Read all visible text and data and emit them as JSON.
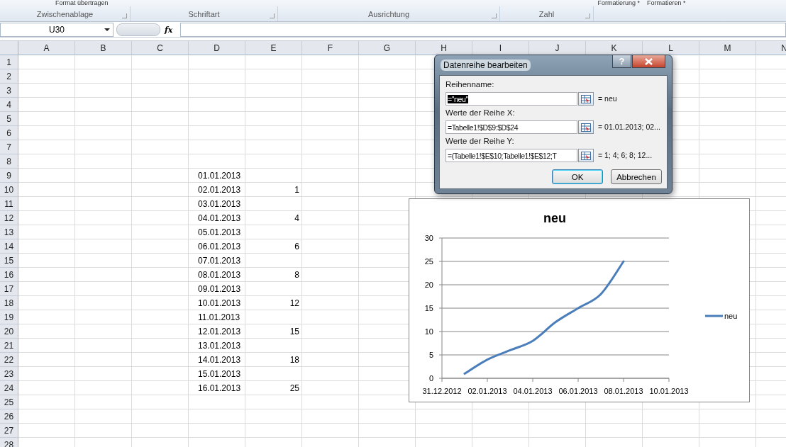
{
  "ribbon": {
    "top_items": [
      {
        "label": "Format übertragen"
      },
      {
        "label": "Formatierung *"
      },
      {
        "label": "Formatieren *"
      }
    ],
    "groups": [
      {
        "label": "Zwischenablage"
      },
      {
        "label": "Schriftart"
      },
      {
        "label": "Ausrichtung"
      },
      {
        "label": "Zahl"
      }
    ]
  },
  "formula_bar": {
    "name_box": "U30",
    "function_label": "fx"
  },
  "sheet": {
    "columns": [
      "A",
      "B",
      "C",
      "D",
      "E",
      "F",
      "G",
      "H",
      "I",
      "J",
      "K",
      "L",
      "M",
      "N"
    ],
    "rows": [
      {
        "header": "1"
      },
      {
        "header": "2"
      },
      {
        "header": "3"
      },
      {
        "header": "4"
      },
      {
        "header": "5"
      },
      {
        "header": "6"
      },
      {
        "header": "7"
      },
      {
        "header": "8"
      },
      {
        "header": "9",
        "date": "01.01.2013"
      },
      {
        "header": "10",
        "date": "02.01.2013",
        "value": "1"
      },
      {
        "header": "11",
        "date": "03.01.2013"
      },
      {
        "header": "12",
        "date": "04.01.2013",
        "value": "4"
      },
      {
        "header": "13",
        "date": "05.01.2013"
      },
      {
        "header": "14",
        "date": "06.01.2013",
        "value": "6"
      },
      {
        "header": "15",
        "date": "07.01.2013"
      },
      {
        "header": "16",
        "date": "08.01.2013",
        "value": "8"
      },
      {
        "header": "17",
        "date": "09.01.2013"
      },
      {
        "header": "18",
        "date": "10.01.2013",
        "value": "12"
      },
      {
        "header": "19",
        "date": "11.01.2013"
      },
      {
        "header": "20",
        "date": "12.01.2013",
        "value": "15"
      },
      {
        "header": "21",
        "date": "13.01.2013"
      },
      {
        "header": "22",
        "date": "14.01.2013",
        "value": "18"
      },
      {
        "header": "23",
        "date": "15.01.2013"
      },
      {
        "header": "24",
        "date": "16.01.2013",
        "value": "25"
      },
      {
        "header": "25"
      },
      {
        "header": "26"
      },
      {
        "header": "27"
      },
      {
        "header": "28"
      }
    ]
  },
  "dialog": {
    "title": "Datenreihe bearbeiten",
    "help": "?",
    "fields": [
      {
        "label": "Reihenname:",
        "value": "=\"neu\"",
        "selected": true,
        "result": "= neu"
      },
      {
        "label": "Werte der Reihe X:",
        "value": "=Tabelle1!$D$9:$D$24",
        "selected": false,
        "result": "= 01.01.2013; 02..."
      },
      {
        "label": "Werte der Reihe Y:",
        "value": "=(Tabelle1!$E$10;Tabelle1!$E$12;T",
        "selected": false,
        "result": "= 1; 4; 6; 8; 12..."
      }
    ],
    "buttons": [
      {
        "label": "OK",
        "default": true
      },
      {
        "label": "Abbrechen",
        "default": false
      }
    ]
  },
  "chart": {
    "chart_data": {
      "type": "line",
      "title": "neu",
      "categories": [
        "31.12.2012",
        null,
        "02.01.2013",
        null,
        "04.01.2013",
        null,
        "06.01.2013",
        null,
        "08.01.2013",
        null,
        "10.01.2013"
      ],
      "series": [
        {
          "name": "neu",
          "color": "#4a7ebb",
          "values": [
            null,
            1,
            4,
            6,
            8,
            12,
            15,
            18,
            25,
            null,
            null
          ]
        }
      ],
      "ylim": [
        0,
        30
      ],
      "grid": true,
      "yticks": [
        0,
        5,
        10,
        15,
        20,
        25,
        30
      ]
    }
  }
}
